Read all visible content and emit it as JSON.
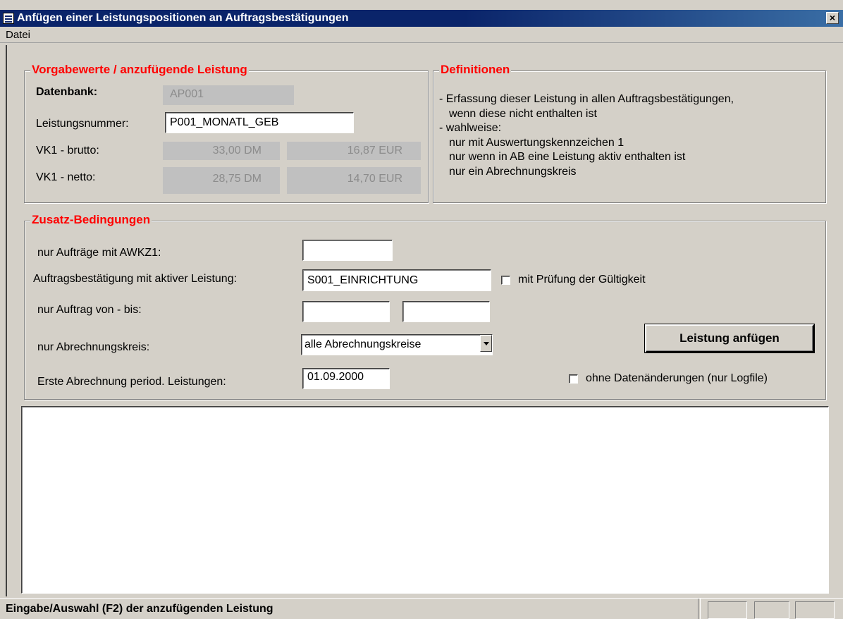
{
  "window": {
    "title": "Anfügen einer Leistungspositionen an Auftragsbestätigungen",
    "close_label": "×"
  },
  "menu": {
    "datei": "Datei"
  },
  "vorgabe": {
    "group_title": "Vorgabewerte / anzufügende Leistung",
    "datenbank_label": "Datenbank:",
    "datenbank_value": "AP001",
    "leistungsnummer_label": "Leistungsnummer:",
    "leistungsnummer_value": "P001_MONATL_GEB",
    "vk1_brutto_label": "VK1 - brutto:",
    "vk1_brutto_dm": "33,00 DM",
    "vk1_brutto_eur": "16,87 EUR",
    "vk1_netto_label": "VK1 - netto:",
    "vk1_netto_dm": "28,75 DM",
    "vk1_netto_eur": "14,70 EUR"
  },
  "definitionen": {
    "group_title": "Definitionen",
    "lines": [
      "- Erfassung dieser Leistung in allen Auftragsbestätigungen,",
      "  wenn diese nicht enthalten ist",
      "- wahlweise:",
      "  nur mit Auswertungskennzeichen 1",
      "  nur wenn in AB eine Leistung aktiv enthalten ist",
      "  nur ein Abrechnungskreis"
    ]
  },
  "zusatz": {
    "group_title": "Zusatz-Bedingungen",
    "awkz1_label": "nur Aufträge mit AWKZ1:",
    "awkz1_value": "",
    "ab_aktiv_label": "Auftragsbestätigung mit aktiver Leistung:",
    "ab_aktiv_value": "S001_EINRICHTUNG",
    "pruefung_label": "mit Prüfung der Gültigkeit",
    "auftrag_label": "nur Auftrag von - bis:",
    "auftrag_von": "",
    "auftrag_bis": "",
    "abrkreis_label": "nur Abrechnungskreis:",
    "abrkreis_value": "alle Abrechnungskreise",
    "erste_abr_label": "Erste Abrechnung period. Leistungen:",
    "erste_abr_value": "01.09.2000",
    "anfuegen_button": "Leistung anfügen",
    "ohne_daten_label": "ohne Datenänderungen (nur Logfile)"
  },
  "status": {
    "text": "Eingabe/Auswahl (F2) der anzufügenden Leistung"
  }
}
